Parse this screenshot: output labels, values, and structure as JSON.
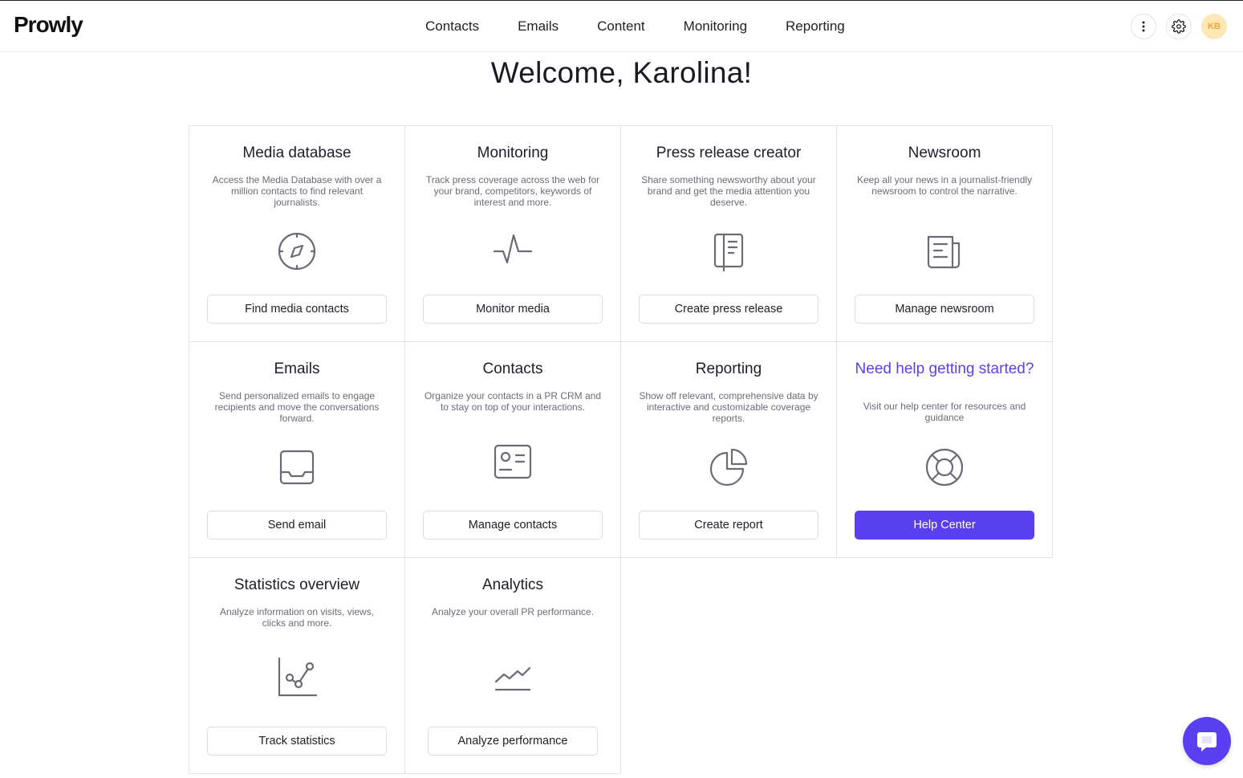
{
  "brand": {
    "logo_text": "Prowly",
    "accent_color": "#5a3ff0"
  },
  "nav": {
    "items": [
      "Contacts",
      "Emails",
      "Content",
      "Monitoring",
      "Reporting"
    ]
  },
  "header": {
    "avatar_initials": "KB"
  },
  "welcome": {
    "title": "Welcome, Karolina!"
  },
  "cards": [
    {
      "title": "Media database",
      "description": "Access the Media Database with over a million contacts to find relevant journalists.",
      "icon": "compass-icon",
      "button": "Find media contacts"
    },
    {
      "title": "Monitoring",
      "description": "Track press coverage across the web for your brand, competitors, keywords of interest and more.",
      "icon": "pulse-icon",
      "button": "Monitor media"
    },
    {
      "title": "Press release creator",
      "description": "Share something newsworthy about your brand and get the media attention you deserve.",
      "icon": "document-icon",
      "button": "Create press release"
    },
    {
      "title": "Newsroom",
      "description": "Keep all your news in a journalist-friendly newsroom to control the narrative.",
      "icon": "newspaper-icon",
      "button": "Manage newsroom"
    },
    {
      "title": "Emails",
      "description": "Send personalized emails to engage recipients and move the conversations forward.",
      "icon": "inbox-icon",
      "button": "Send email"
    },
    {
      "title": "Contacts",
      "description": "Organize your contacts in a PR CRM and to stay on top of your interactions.",
      "icon": "contact-card-icon",
      "button": "Manage contacts"
    },
    {
      "title": "Reporting",
      "description": "Show off relevant, comprehensive data by interactive and customizable coverage reports.",
      "icon": "pie-chart-icon",
      "button": "Create report"
    },
    {
      "title": "Need help getting started?",
      "description": "Visit our help center for resources and guidance",
      "icon": "lifebuoy-icon",
      "button": "Help Center"
    },
    {
      "title": "Statistics overview",
      "description": "Analyze information on visits, views, clicks and more.",
      "icon": "scatter-chart-icon",
      "button": "Track statistics"
    },
    {
      "title": "Analytics",
      "description": "Analyze your overall PR performance.",
      "icon": "line-chart-icon",
      "button": "Analyze performance"
    }
  ]
}
